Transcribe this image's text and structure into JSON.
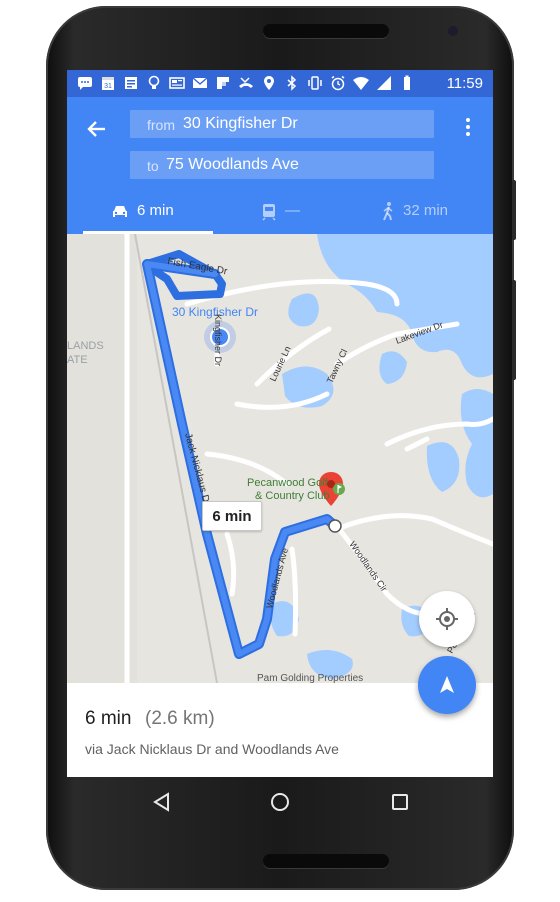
{
  "status_bar": {
    "time": "11:59",
    "icons": [
      "chat-icon",
      "calendar-icon",
      "notes-icon",
      "bulb-icon",
      "news-icon",
      "mail-icon",
      "flipboard-icon",
      "missed-call-icon",
      "location-icon",
      "bluetooth-icon",
      "vibrate-icon",
      "alarm-icon",
      "wifi-icon",
      "signal-icon",
      "battery-icon"
    ],
    "calendar_day": "31"
  },
  "directions": {
    "from_label": "from",
    "from_value": "30 Kingfisher Dr",
    "to_label": "to",
    "to_value": "75 Woodlands Ave"
  },
  "modes": [
    {
      "name": "drive",
      "label": "6 min",
      "selected": true
    },
    {
      "name": "transit",
      "label": "—",
      "selected": false
    },
    {
      "name": "walk",
      "label": "32 min",
      "selected": false
    }
  ],
  "map": {
    "labels": {
      "fish_eagle": "Fish Eagle Dr",
      "kingfisher_addr": "30 Kingfisher Dr",
      "kingfisher_road": "Kingfisher Dr",
      "lourie": "Lourie Ln",
      "tawny": "Tawny Cl",
      "lakeview": "Lakeview Dr",
      "lands": "LANDS",
      "ate": "ATE",
      "jack_nicklaus": "Jack Nicklaus Dr",
      "golf_line1": "Pecanwood Golf",
      "golf_line2": "& Country Club",
      "woodlands_cir": "Woodlands Cir",
      "woodlands_ave": "Woodlands Ave",
      "pecanwood_road": "Pecanwood",
      "pam_golding": "Pam Golding Properties"
    },
    "route_bubble": "6 min",
    "colors": {
      "route": "#4a89f3",
      "water": "#a3ccff",
      "land": "#e7e5e0",
      "road": "#ffffff",
      "park": "#cde6c7",
      "pin": "#ea4335"
    }
  },
  "summary": {
    "time": "6 min",
    "distance": "(2.6 km)",
    "via": "via Jack Nicklaus Dr and Woodlands Ave"
  },
  "navigation": {
    "back": "back-icon",
    "home": "home-icon",
    "recents": "recents-icon"
  }
}
